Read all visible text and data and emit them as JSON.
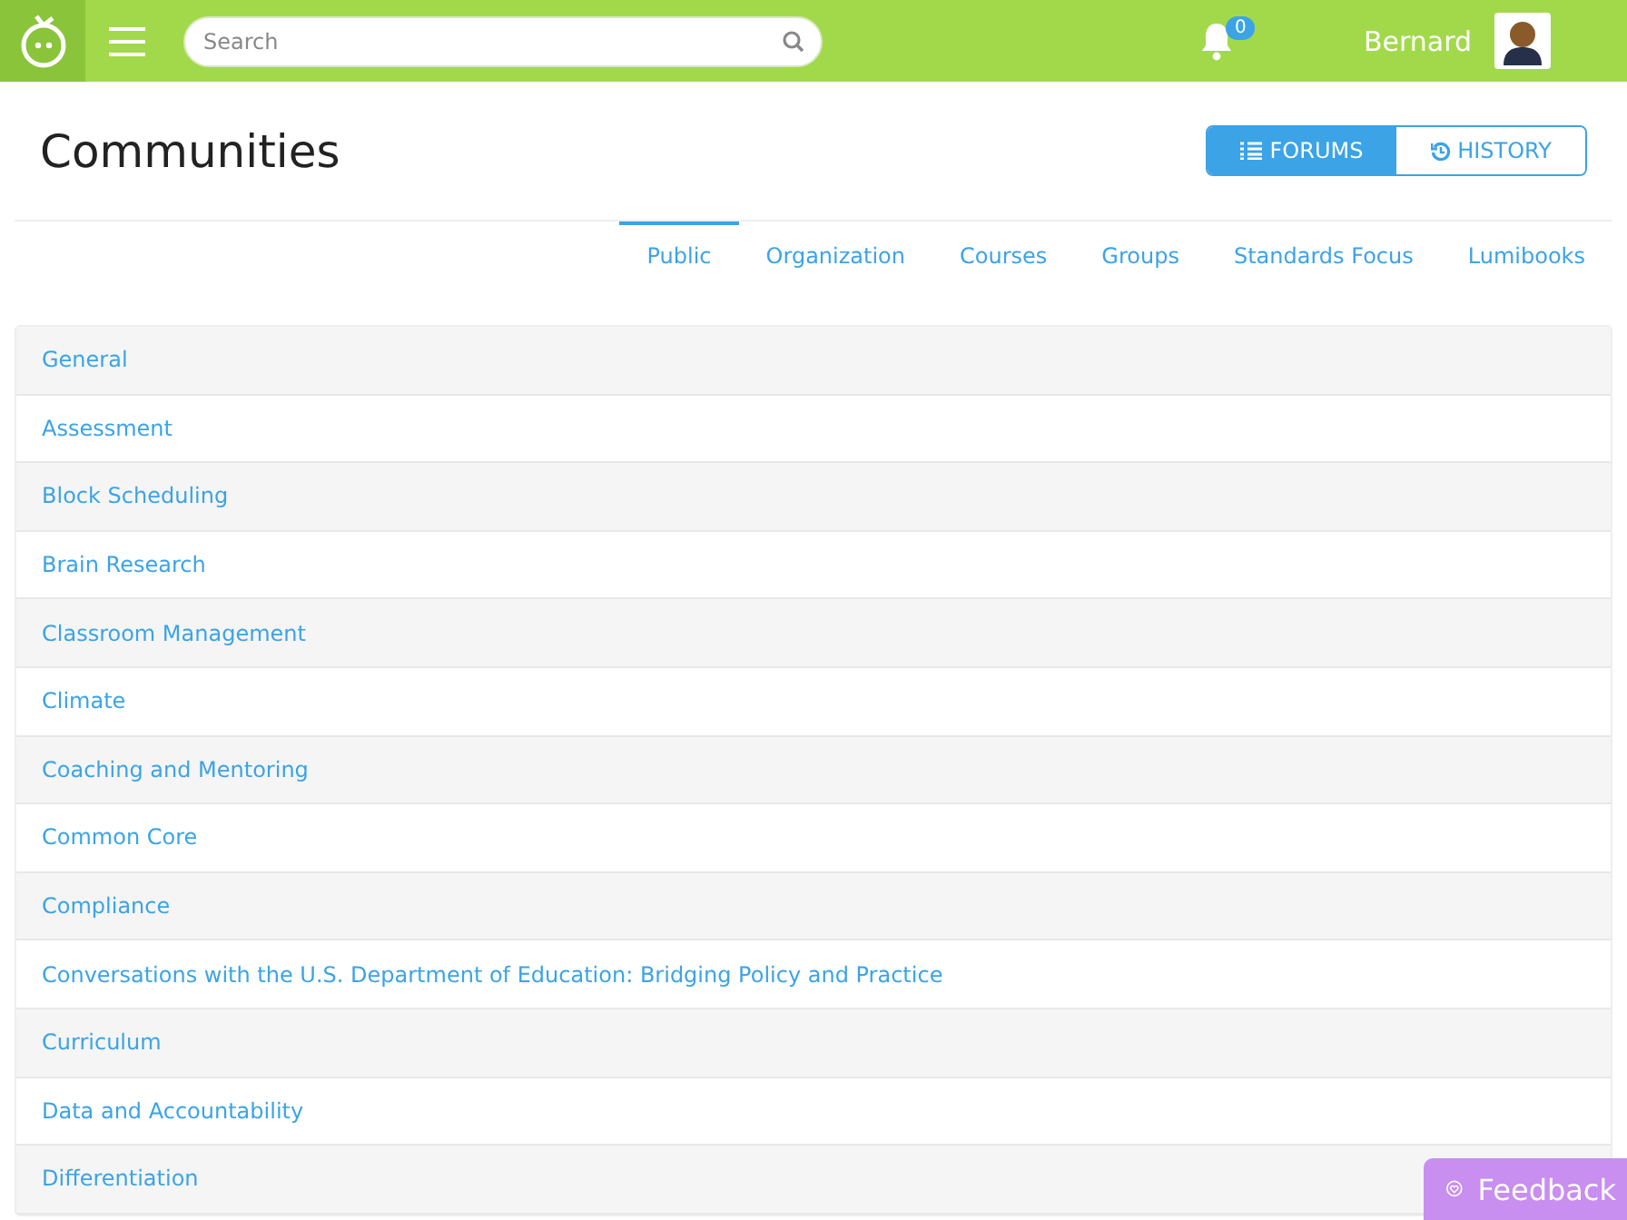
{
  "header": {
    "search": {
      "placeholder": "Search"
    },
    "notifications": "0",
    "user": "Bernard"
  },
  "page": {
    "title": "Communities",
    "view_toggle": [
      {
        "kind": "list",
        "label": "FORUMS",
        "selected": true
      },
      {
        "kind": "history",
        "label": "HISTORY",
        "selected": false
      }
    ],
    "tabs": [
      {
        "label": "Public",
        "selected": true
      },
      {
        "label": "Organization",
        "selected": false
      },
      {
        "label": "Courses",
        "selected": false
      },
      {
        "label": "Groups",
        "selected": false
      },
      {
        "label": "Standards Focus",
        "selected": false
      },
      {
        "label": "Lumibooks",
        "selected": false
      }
    ],
    "forums": [
      "General",
      "Assessment",
      "Block Scheduling",
      "Brain Research",
      "Classroom Management",
      "Climate",
      "Coaching and Mentoring",
      "Common Core",
      "Compliance",
      "Conversations with the U.S. Department of Education: Bridging Policy and Practice",
      "Curriculum",
      "Data and Accountability",
      "Differentiation"
    ]
  },
  "feedback": "Feedback"
}
